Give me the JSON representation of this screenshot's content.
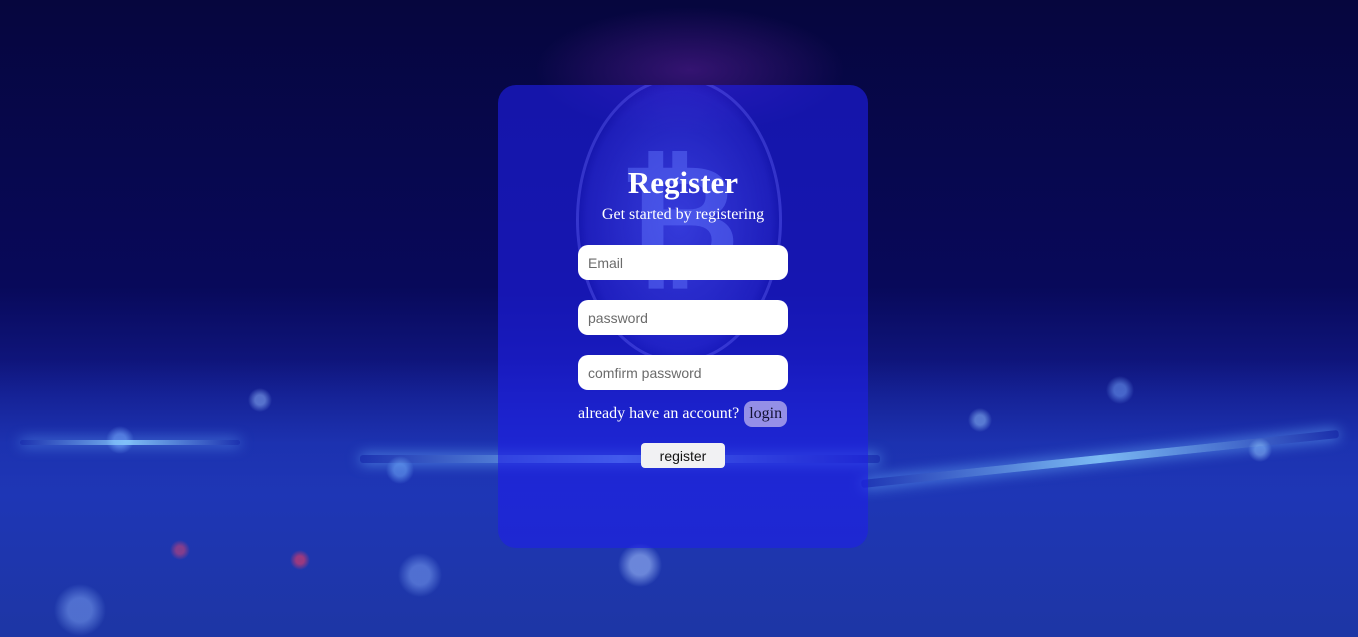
{
  "register": {
    "title": "Register",
    "subtitle": "Get started by registering",
    "email_placeholder": "Email",
    "password_placeholder": "password",
    "confirm_placeholder": "comfirm password",
    "account_prompt": "already have an account?",
    "login_label": "login",
    "register_label": "register"
  },
  "colors": {
    "card_bg": "#1e1ee6",
    "page_bg": "#07084a"
  },
  "icons": {
    "background": "bitcoin-coin-icon"
  }
}
